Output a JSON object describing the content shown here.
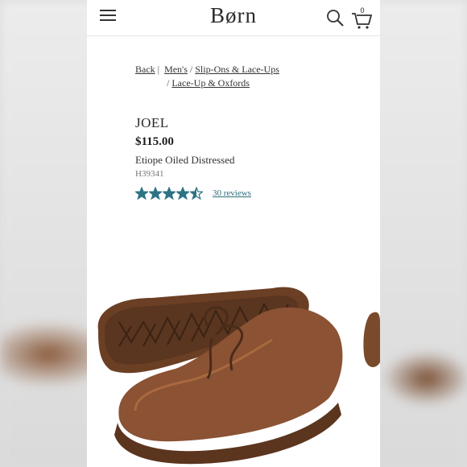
{
  "header": {
    "logo_text": "Børn",
    "cart_count": "0",
    "icons": [
      "menu-icon",
      "search-icon",
      "cart-icon"
    ]
  },
  "breadcrumb": {
    "back": "Back",
    "separator1": " |",
    "mens": "Men's",
    "sep": "/",
    "slip_ons": "Slip-Ons & Lace-Ups",
    "lace_up": "Lace-Up & Oxfords"
  },
  "product": {
    "name": "JOEL",
    "price": "$115.00",
    "color": "Etiope Oiled Distressed",
    "sku": "H39341",
    "rating": 4.5,
    "reviews": "30 reviews"
  },
  "colors": {
    "star": "#2e7384",
    "leather": "#8b5233",
    "sole": "#6b3f24"
  }
}
